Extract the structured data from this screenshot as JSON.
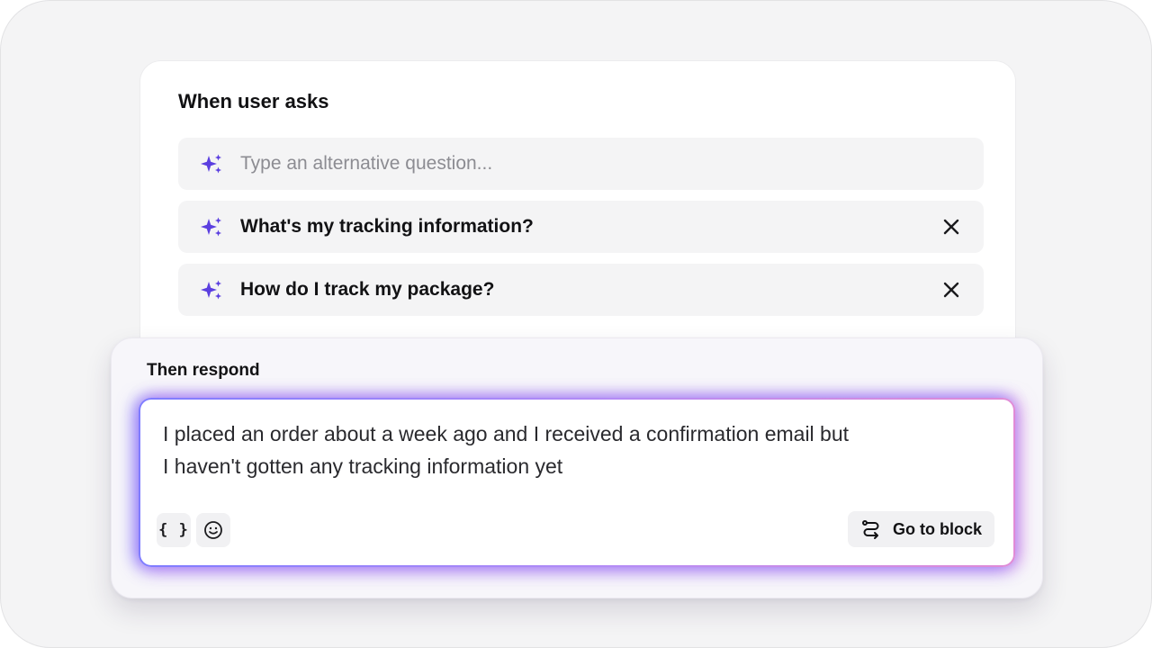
{
  "ask_section": {
    "title": "When user asks",
    "input_placeholder": "Type an alternative question...",
    "questions": [
      {
        "text": "What's my tracking information?"
      },
      {
        "text": "How do I track my package?"
      }
    ]
  },
  "respond_section": {
    "title": "Then respond",
    "response_text": "I placed an order about a week ago and I received a confirmation email but\nI haven't gotten any tracking information yet",
    "variable_button_label": "{ }",
    "goto_button_label": "Go to block"
  },
  "icons": {
    "question": "sparkles-icon",
    "remove": "close-icon",
    "emoji": "smiley-icon",
    "goto": "route-icon"
  },
  "colors": {
    "accent_purple": "#5b3fe0",
    "glow_blue": "#7f7cff",
    "glow_pink": "#e08bd6",
    "row_background": "#f4f4f5"
  }
}
